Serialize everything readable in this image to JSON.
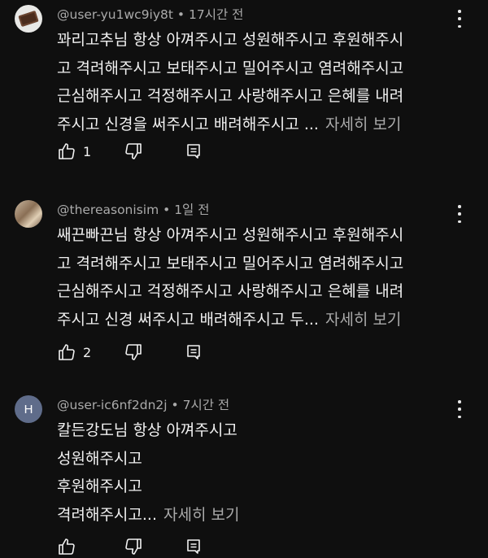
{
  "comments": [
    {
      "handle": "@user-yu1wc9iy8t",
      "time": "17시간 전",
      "lines": [
        "꽈리고추님 항상 아껴주시고 성원해주시고 후원해주시",
        "고 격려해주시고 보태주시고 밀어주시고 염려해주시고",
        "근심해주시고 걱정해주시고 사랑해주시고 은혜를 내려",
        "주시고 신경을 써주시고 배려해주시고 ..."
      ],
      "more_label": "자세히 보기",
      "likes": "1"
    },
    {
      "handle": "@thereasonisim",
      "time": "1일 전",
      "lines": [
        "쌔끈빠끈님 항상 아껴주시고 성원해주시고 후원해주시",
        "고 격려해주시고 보태주시고 밀어주시고 염려해주시고",
        "근심해주시고 걱정해주시고 사랑해주시고 은혜를 내려",
        "주시고 신경 써주시고 배려해주시고 두..."
      ],
      "more_label": "자세히 보기",
      "likes": "2"
    },
    {
      "handle": "@user-ic6nf2dn2j",
      "time": "7시간 전",
      "avatar_letter": "H",
      "lines": [
        "칼든강도님 항상 아껴주시고",
        "성원해주시고",
        "후원해주시고",
        "격려해주시고..."
      ],
      "more_label": "자세히 보기",
      "likes": ""
    }
  ],
  "meta_separator": " • ",
  "icons": [
    "like-icon",
    "dislike-icon",
    "reply-icon",
    "more-vert-icon"
  ],
  "colors": {
    "background": "#0f0f0f",
    "text": "#f1f1f1",
    "secondary": "#aaaaaa",
    "avatar_h": "#5f6c8a"
  }
}
